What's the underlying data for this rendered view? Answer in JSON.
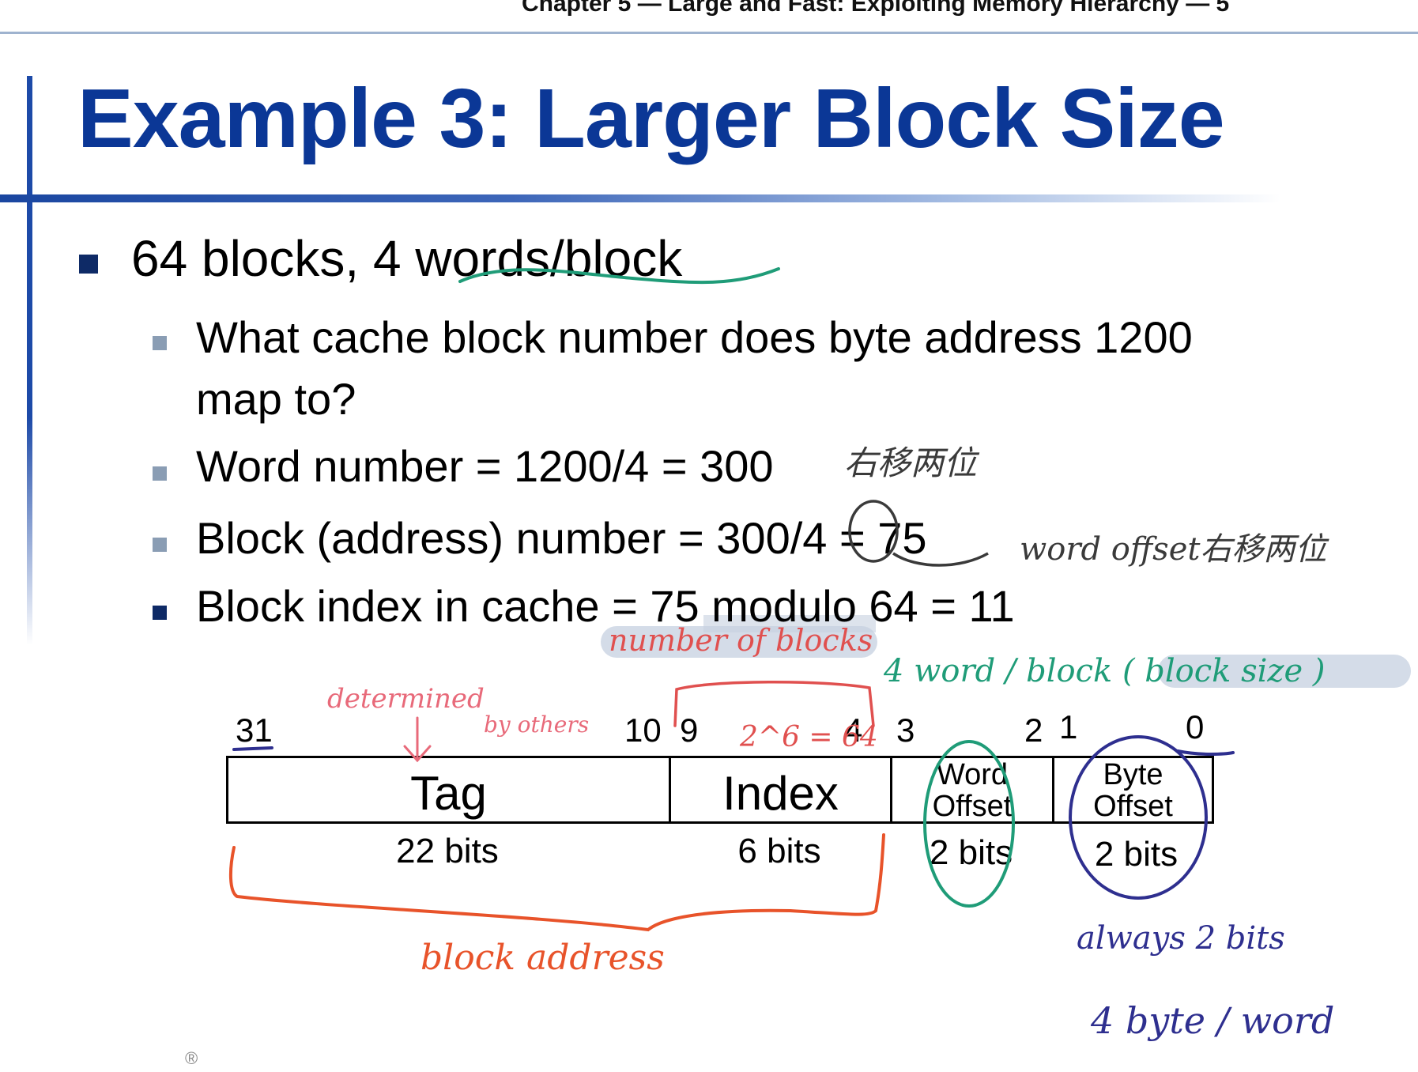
{
  "header": {
    "text": "Chapter 5 — Large and Fast: Exploiting Memory Hierarchy — 5"
  },
  "slide": {
    "title": "Example 3: Larger Block Size",
    "bullets": [
      {
        "level": 1,
        "text": "64 blocks, 4 words/block"
      },
      {
        "level": 2,
        "text": "What cache block number does byte address 1200"
      },
      {
        "level": 2,
        "text": "map to?"
      },
      {
        "level": 2,
        "text": "Word number = 1200/4 = 300"
      },
      {
        "level": 2,
        "text": "Block (address) number = 300/4 = 75"
      },
      {
        "level": 2,
        "text": "Block index in cache = 75 modulo 64 = 11"
      }
    ]
  },
  "address_diagram": {
    "bit_numbers": {
      "b31": "31",
      "b10": "10",
      "b9": "9",
      "b4": "4",
      "b3": "3",
      "b2": "2",
      "b1": "1",
      "b0": "0"
    },
    "fields": [
      {
        "name": "Tag",
        "bits": "22 bits"
      },
      {
        "name": "Index",
        "bits": "6 bits"
      },
      {
        "name_line1": "Word",
        "name_line2": "Offset",
        "bits": "2 bits"
      },
      {
        "name_line1": "Byte",
        "name_line2": "Offset",
        "bits": "2 bits"
      }
    ]
  },
  "annotations": {
    "right_shift_two": "右移两位",
    "word_offset_shift": "word offset右移两位",
    "number_of_blocks": "number of blocks",
    "word_per_block": "4 word / block ( block size )",
    "determined": "determined",
    "by_others": "by others",
    "two_pow": "2^6 = 64",
    "block_address": "block address",
    "always_2_bits": "always 2 bits",
    "byte_per_word": "4 byte / word"
  },
  "colors": {
    "title": "#0b3796",
    "ink_teal": "#1f9c78",
    "ink_red": "#e0504f",
    "ink_orange": "#e8532a",
    "ink_navy": "#2e2f8f",
    "ink_pink": "#e86a7a",
    "ink_dark": "#3a3a3a",
    "highlight": "#c6d0e0"
  }
}
